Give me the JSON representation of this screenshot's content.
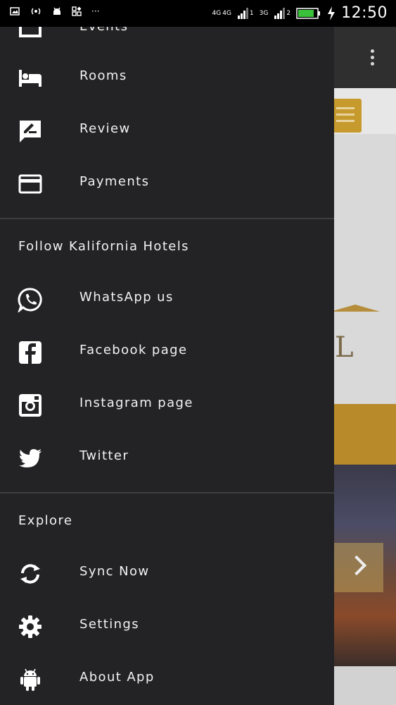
{
  "status_bar": {
    "network_1": "4G",
    "network_2": "4G",
    "sim_1": "1",
    "network_3": "3G",
    "sim_2": "2",
    "time": "12:50",
    "more": "···"
  },
  "drawer": {
    "top_items": [
      {
        "label": "Events",
        "icon": "events-icon"
      },
      {
        "label": "Rooms",
        "icon": "bed-icon"
      },
      {
        "label": "Review",
        "icon": "review-icon"
      },
      {
        "label": "Payments",
        "icon": "credit-card-icon"
      }
    ],
    "follow_section": {
      "title": "Follow Kalifornia Hotels",
      "items": [
        {
          "label": "WhatsApp us",
          "icon": "whatsapp-icon"
        },
        {
          "label": "Facebook page",
          "icon": "facebook-icon"
        },
        {
          "label": "Instagram page",
          "icon": "instagram-icon"
        },
        {
          "label": "Twitter",
          "icon": "twitter-icon"
        }
      ]
    },
    "explore_section": {
      "title": "Explore",
      "items": [
        {
          "label": "Sync Now",
          "icon": "sync-icon"
        },
        {
          "label": "Settings",
          "icon": "gear-icon"
        },
        {
          "label": "About App",
          "icon": "android-icon"
        }
      ]
    }
  },
  "background_app": {
    "logo_letter": "L"
  },
  "colors": {
    "drawer_bg": "#232224",
    "accent_gold": "#c79a2e",
    "text": "#f2f2f2"
  }
}
